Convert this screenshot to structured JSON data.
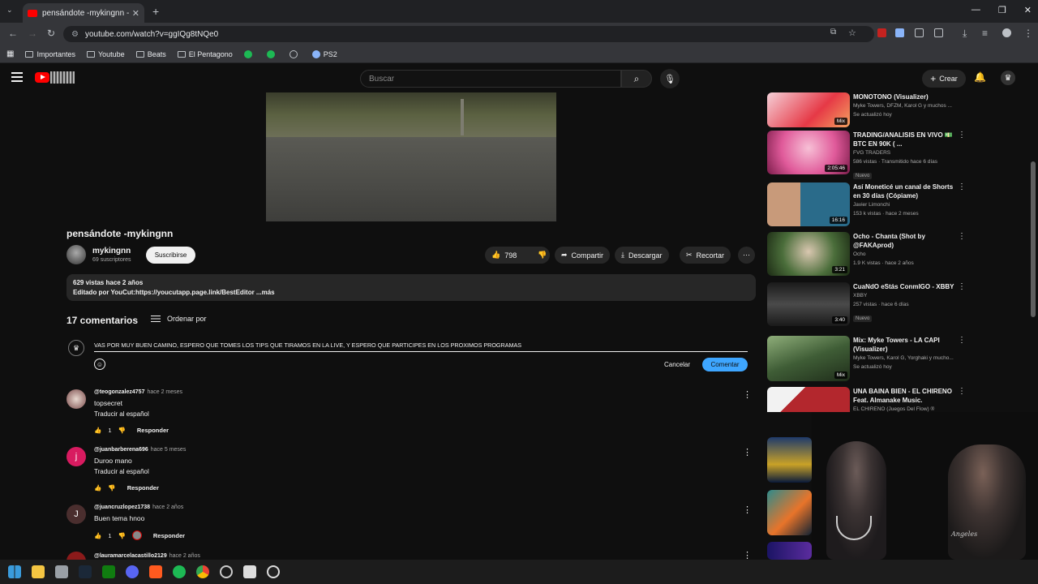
{
  "browser": {
    "tab_title": "pensándote -mykingnn - YouTube",
    "url": "youtube.com/watch?v=ggIQg8tNQe0",
    "bookmarks": [
      {
        "label": "Importantes",
        "type": "folder"
      },
      {
        "label": "Youtube",
        "type": "folder"
      },
      {
        "label": "Beats",
        "type": "folder"
      },
      {
        "label": "El Pentagono",
        "type": "folder"
      },
      {
        "label": "",
        "type": "site",
        "color": "#1db954"
      },
      {
        "label": "",
        "type": "site",
        "color": "#1db954"
      },
      {
        "label": "",
        "type": "site",
        "color": "#bdc1c6"
      },
      {
        "label": "PS2",
        "type": "site",
        "color": "#8ab4f8"
      }
    ]
  },
  "header": {
    "search_placeholder": "Buscar",
    "create_label": "Crear"
  },
  "video": {
    "title": "pensándote -mykingnn",
    "channel": "mykingnn",
    "subscribers": "69 suscriptores",
    "subscribe_label": "Suscribirse",
    "likes": "798",
    "share_label": "Compartir",
    "download_label": "Descargar",
    "clip_label": "Recortar",
    "description_meta": "629 vistas  hace 2 años",
    "description_text": "Editado por YouCut:https://youcutapp.page.link/BestEditor ...más"
  },
  "comments": {
    "count_label": "17 comentarios",
    "sort_label": "Ordenar por",
    "draft": "VAS POR MUY BUEN CAMINO, ESPERO QUE TOMES LOS TIPS QUE TIRAMOS EN LA LIVE, Y ESPERO QUE PARTICIPES EN LOS PROXIMOS PROGRAMAS",
    "cancel_label": "Cancelar",
    "submit_label": "Comentar",
    "items": [
      {
        "handle": "@teogonzalez4757",
        "time": "hace 2 meses",
        "text": "topsecret",
        "translate": "Traducir al español",
        "likes": "1",
        "reply": "Responder"
      },
      {
        "handle": "@juanbarberena696",
        "time": "hace 5 meses",
        "text": "Duroo mano",
        "translate": "Traducir al español",
        "likes": "",
        "reply": "Responder",
        "avatar_letter": "j"
      },
      {
        "handle": "@juancruzlopez1738",
        "time": "hace 2 años",
        "text": "Buen tema hnoo",
        "translate": "",
        "likes": "1",
        "reply": "Responder",
        "avatar_letter": "J"
      },
      {
        "handle": "@lauramarcelacastillo2129",
        "time": "hace 2 años"
      }
    ]
  },
  "recommendations": [
    {
      "title": "MONOTONO (Visualizer)",
      "channel": "Myke Towers, DFZM, Karol G y muchos ...",
      "meta": "Se actualizó hoy",
      "badge": "Mix"
    },
    {
      "title": "TRADING/ANALISIS EN VIVO 💵 BTC EN 90K ( ...",
      "channel": "FVG TRADERS",
      "meta": "586 vistas · Transmitido hace 6 días",
      "badge": "2:05:46",
      "new": "Nuevo"
    },
    {
      "title": "Así Moneticé un canal de Shorts en 30 días (Cópiame)",
      "channel": "Javier Limonchi",
      "meta": "153 k vistas · hace 2 meses",
      "badge": "16:16"
    },
    {
      "title": "Ocho - Chanta (Shot by @FAKAprod)",
      "channel": "Ocho",
      "meta": "1.9 K vistas · hace 2 años",
      "badge": "3:21"
    },
    {
      "title": "CuaNdO eStás ConmIGO - XBBY",
      "channel": "XBBY",
      "meta": "257 vistas · hace 6 días",
      "badge": "3:40",
      "new": "Nuevo"
    },
    {
      "title": "Mix: Myke Towers - LA CAPI (Visualizer)",
      "channel": "Myke Towers, Karol G, Yorghaki y mucho...",
      "meta": "Se actualizó hoy",
      "badge": "Mix"
    },
    {
      "title": "UNA BAINA BIEN - EL CHIRENO Feat. Almanake Music.",
      "channel": "EL CHIRENO (Juegos Del Flow) ®",
      "meta": "",
      "badge": ""
    }
  ],
  "thumb_colors": [
    "#e63946",
    "#e05a9a",
    "#2a6b8a",
    "#4a6d3a",
    "#3a3a3a",
    "#3f5d36",
    "#b3272d"
  ]
}
